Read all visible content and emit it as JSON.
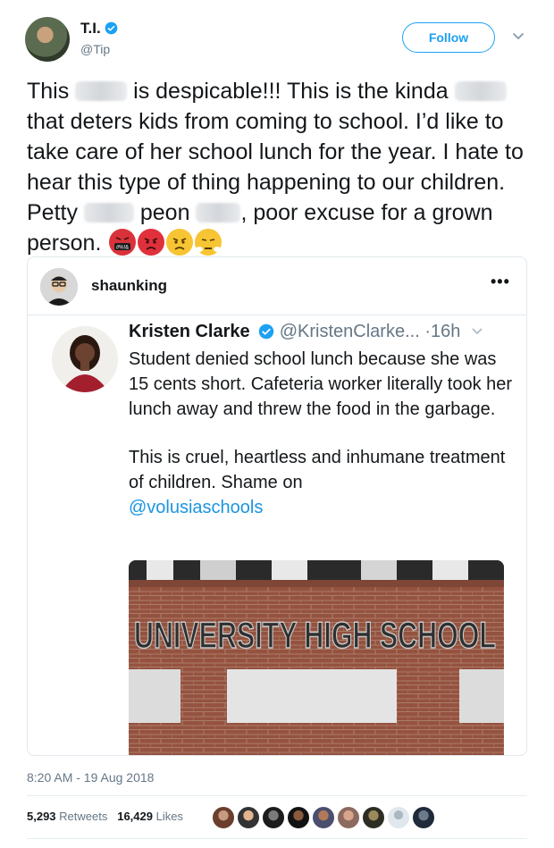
{
  "author": {
    "name": "T.I.",
    "handle": "@Tip",
    "follow_label": "Follow"
  },
  "tweet": {
    "part1": "This ",
    "part2": " is despicable!!! This is the kinda ",
    "part3": " that deters kids from coming to school. I’d like to take care of her school lunch for the year. I hate to hear this type of thing happening to our children. Petty ",
    "part4": " peon ",
    "part5": ", poor excuse for a grown person. ",
    "emoji_1_text": "#%!&"
  },
  "quote": {
    "retweeter_name": "shaunking",
    "more_label": "•••",
    "inner": {
      "name": "Kristen Clarke",
      "handle_time": "@KristenClarke... ·16h",
      "body1": "Student denied school lunch because she was 15 cents short. Cafeteria worker literally took her lunch away and threw the food in the garbage.",
      "body2": "This is cruel, heartless and inhumane treatment of children. Shame on",
      "mention": "@volusiaschools",
      "photo_sign_text": "UNIVERSITY HIGH SCHOOL"
    }
  },
  "timestamp": "8:20 AM - 19 Aug 2018",
  "stats": {
    "retweets_count": "5,293",
    "retweets_label": "Retweets",
    "likes_count": "16,429",
    "likes_label": "Likes"
  },
  "colors": {
    "accent": "#1da1f2",
    "secondary_text": "#657786",
    "link": "#1b95e0",
    "verified": "#1da1f2"
  }
}
